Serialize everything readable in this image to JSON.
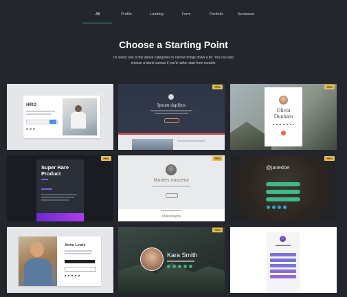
{
  "tabs": [
    "All",
    "Profile",
    "Landing",
    "Form",
    "Portfolio",
    "Sectioned"
  ],
  "heading": "Choose a Starting Point",
  "subheading": "Or select one of the above categories to narrow things down a bit. You can also choose a blank canvas if you'd rather start from scratch.",
  "pro_label": "PRO",
  "cards": {
    "hiro": {
      "title": "HIRO"
    },
    "ipsum": {
      "title": "Ipsum dapibus"
    },
    "olivia": {
      "first": "Olivia",
      "last": "Dunham"
    },
    "superrare": {
      "title_line1": "Super Rare",
      "title_line2": "Product"
    },
    "montes": {
      "title": "Montes nascetur",
      "footer": "Makeslayda"
    },
    "janedoe": {
      "handle": "@janedoe"
    },
    "anne": {
      "name": "Anne Lewis"
    },
    "kara": {
      "name": "Kara Smith"
    }
  },
  "colors": {
    "accent": "#3fa9a0",
    "pro_badge": "#e6c04a",
    "background": "#23262d"
  }
}
